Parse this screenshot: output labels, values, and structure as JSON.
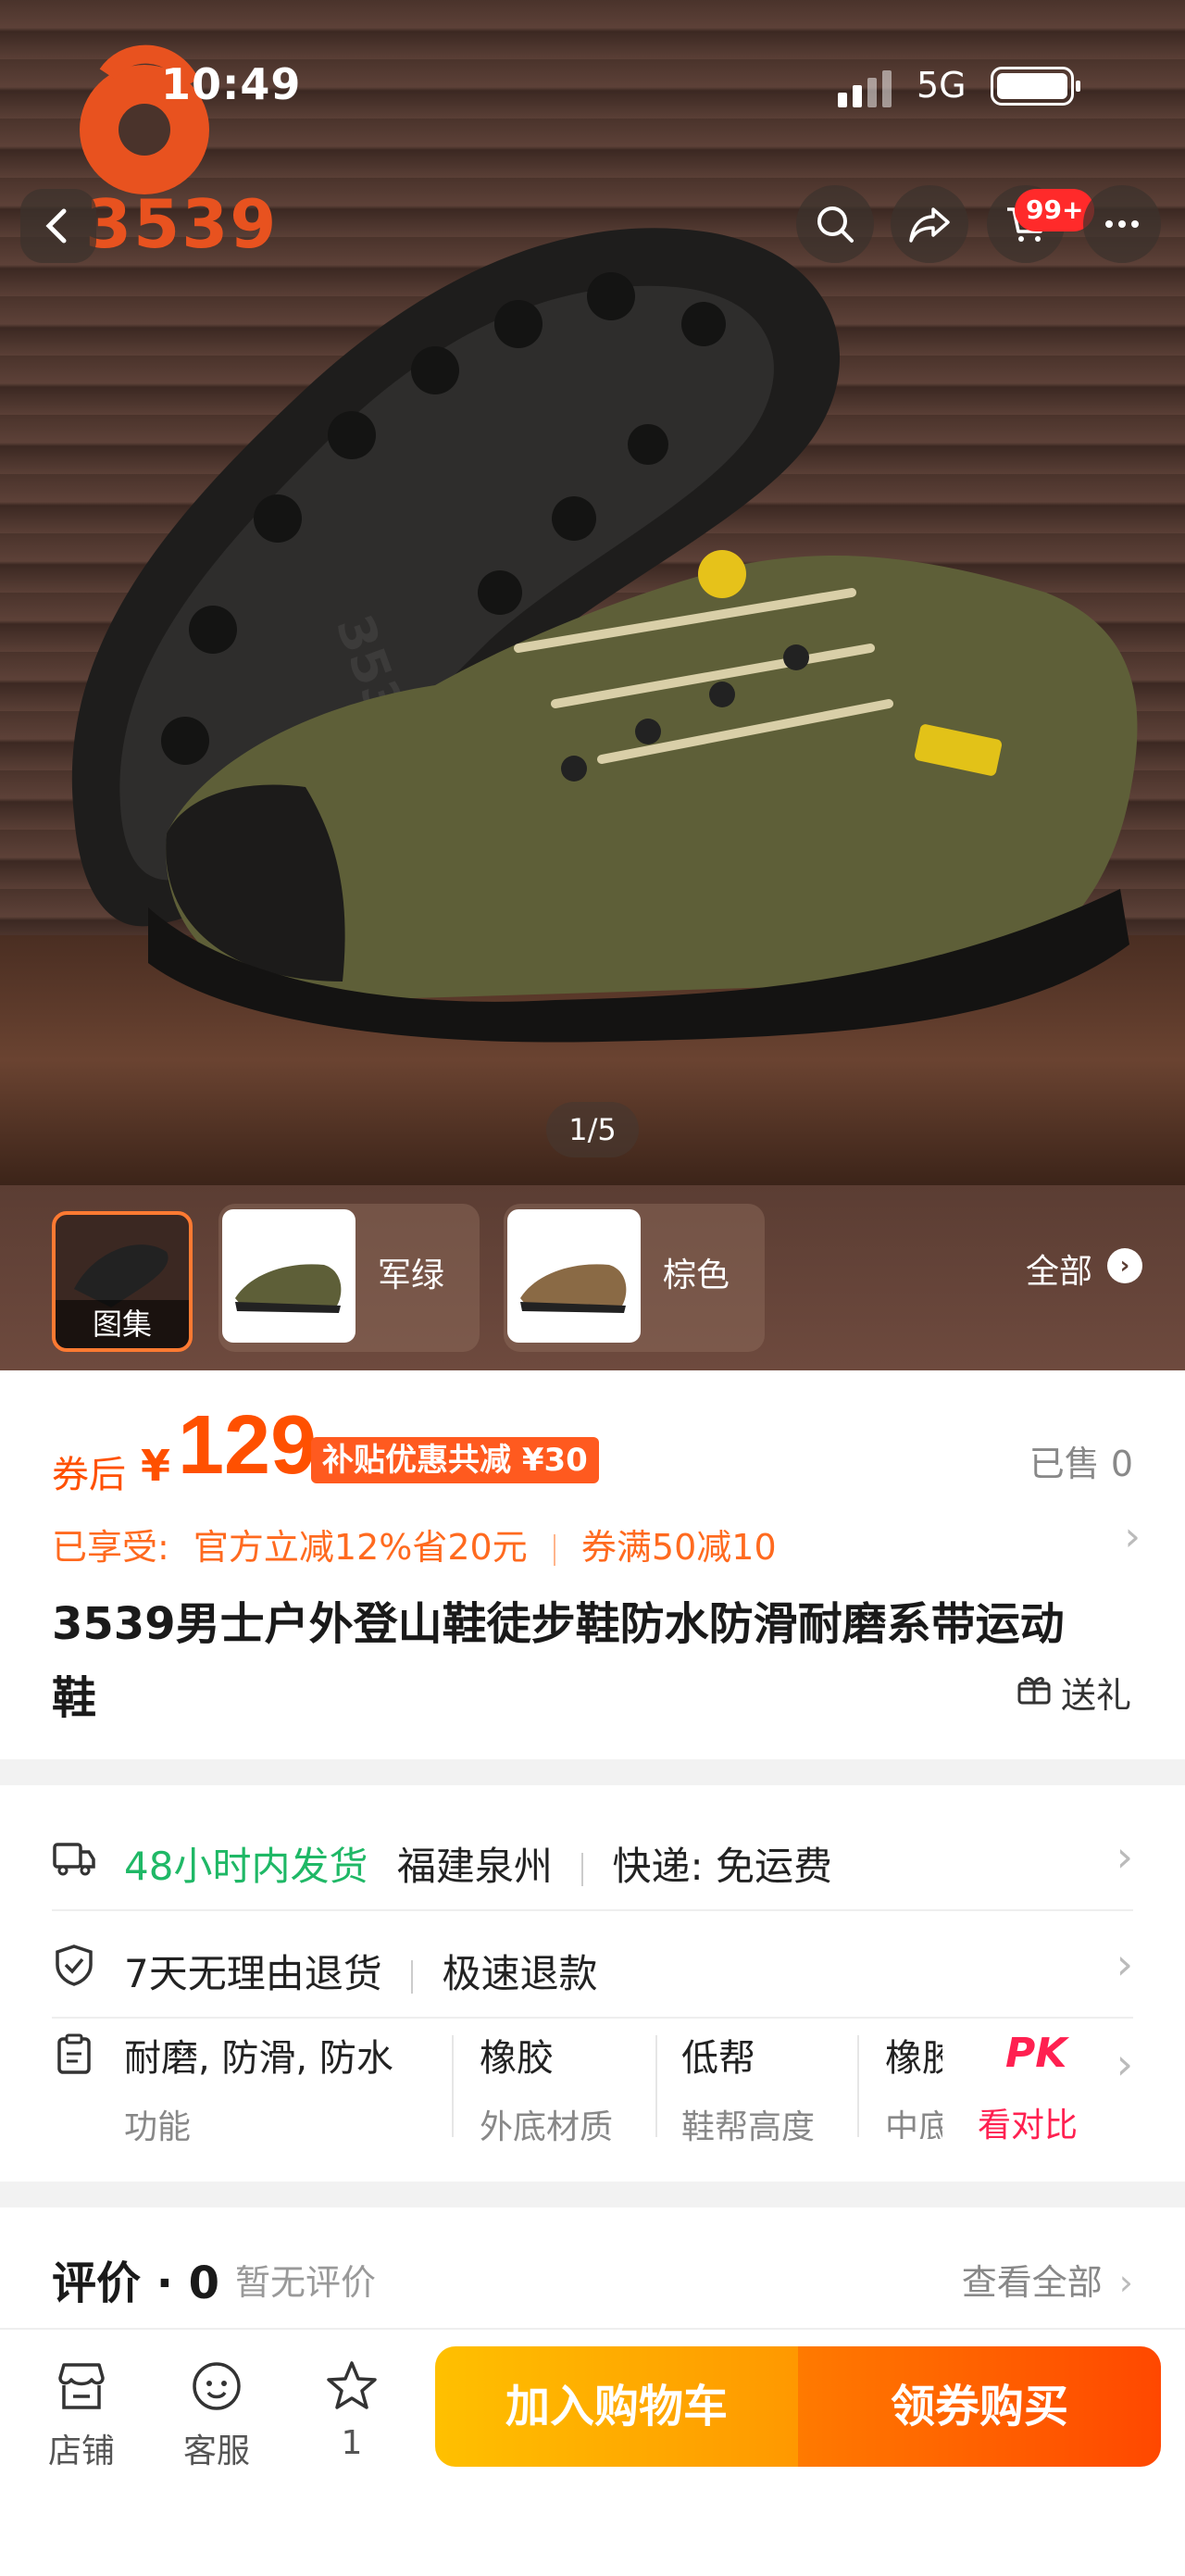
{
  "status_bar": {
    "time": "10:49",
    "network": "5G"
  },
  "brand": {
    "logo_text": "3539"
  },
  "header": {
    "cart_badge": "99+"
  },
  "gallery": {
    "counter": "1/5"
  },
  "variants": {
    "gallery_label": "图集",
    "items": [
      {
        "label": "军绿"
      },
      {
        "label": "棕色"
      }
    ],
    "view_all": "全部"
  },
  "price": {
    "prefix": "券后",
    "currency": "¥",
    "value": "129",
    "subsidy": "补贴优惠共减 ¥30",
    "sold": "已售 0",
    "enjoyed_label": "已享受:",
    "discount_official": "官方立减12%省20元",
    "discount_coupon": "券满50减10"
  },
  "product": {
    "title": "3539男士户外登山鞋徒步鞋防水防滑耐磨系带运动鞋",
    "gift_label": "送礼"
  },
  "shipping": {
    "dispatch": "48小时内发货",
    "origin": "福建泉州",
    "courier": "快递: 免运费"
  },
  "service": {
    "return_policy": "7天无理由退货",
    "refund": "极速退款"
  },
  "attributes": {
    "items": [
      {
        "value": "耐磨, 防滑, 防水",
        "key": "功能"
      },
      {
        "value": "橡胶",
        "key": "外底材质"
      },
      {
        "value": "低帮",
        "key": "鞋帮高度"
      },
      {
        "value": "橡胶",
        "key": "中底"
      }
    ],
    "pk_badge": "PK",
    "pk_label": "看对比"
  },
  "reviews": {
    "title": "评价 · 0",
    "empty": "暂无评价",
    "view_all": "查看全部"
  },
  "bottom_bar": {
    "shop": "店铺",
    "service": "客服",
    "favorites_count": "1",
    "add_to_cart": "加入购物车",
    "buy_with_coupon": "领券购买"
  },
  "colors": {
    "accent_orange": "#ff5000",
    "green": "#1fb866",
    "cart_button": "#ffb000",
    "buy_button": "#ff5a00",
    "pk_red": "#ff2050"
  }
}
